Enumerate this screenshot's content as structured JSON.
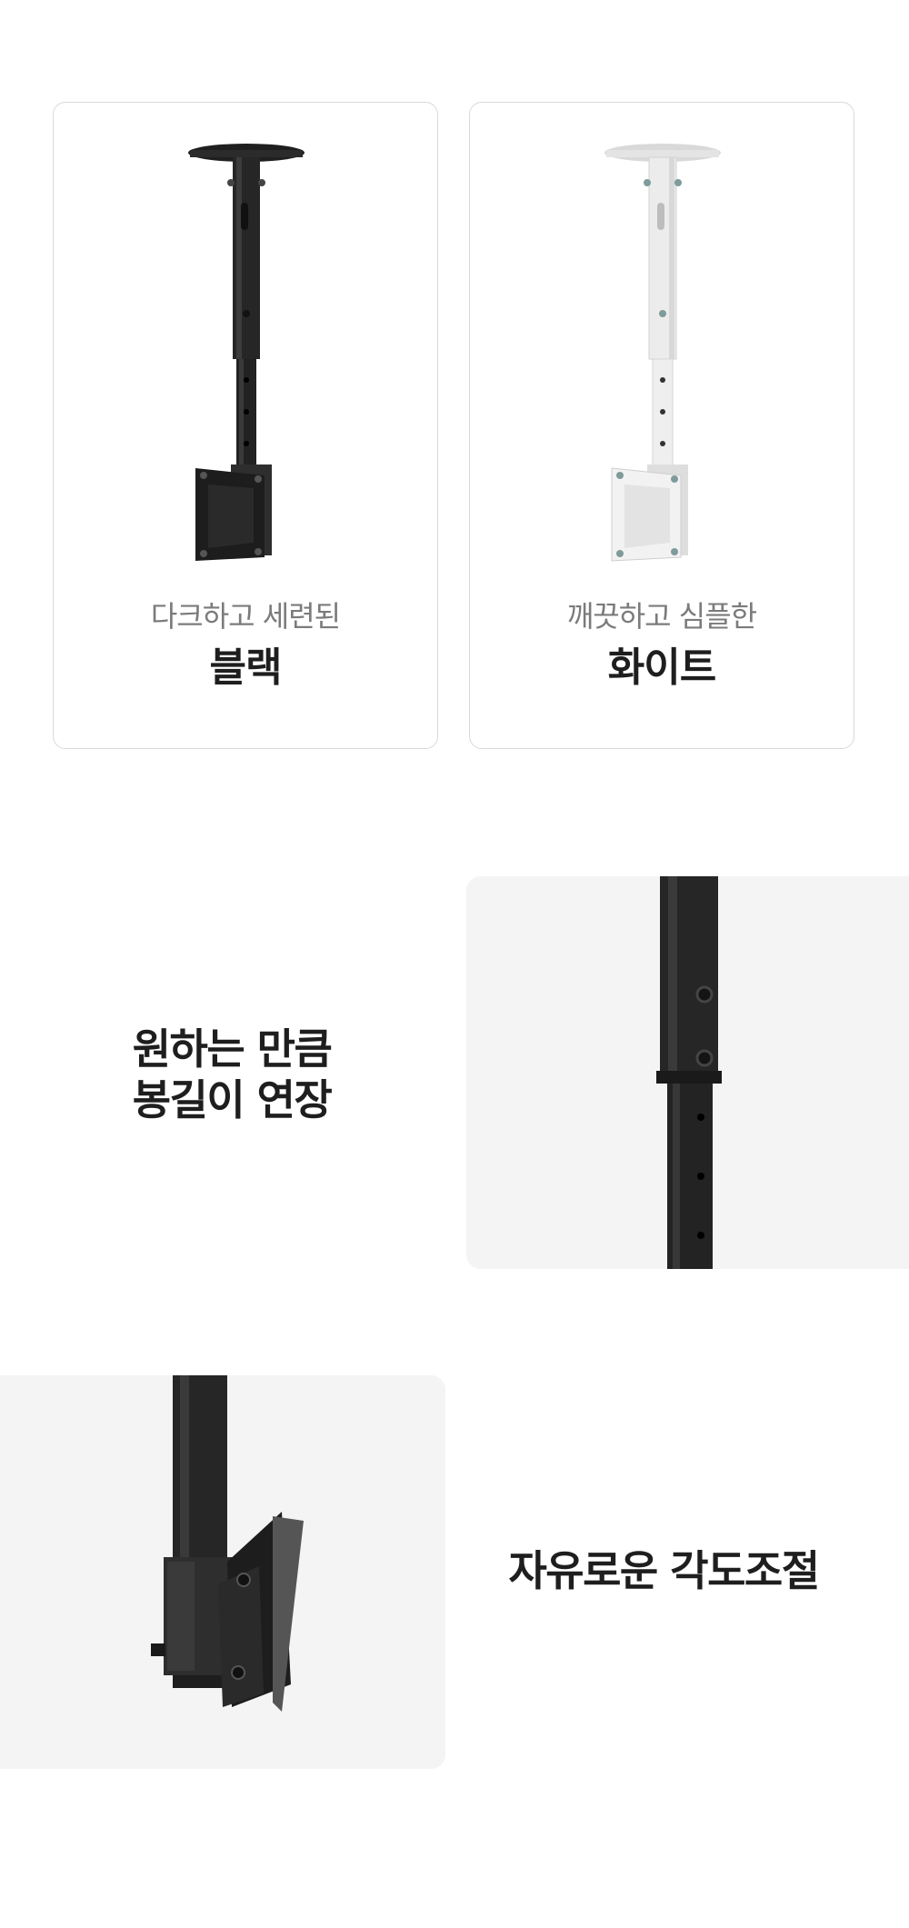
{
  "colors": {
    "card_border": "#d9d9d9",
    "photo_background": "#f4f4f4",
    "subtitle_text": "#7b7b7b",
    "title_text": "#1e1e1e",
    "mount_black": "#2a2a2a",
    "mount_white": "#e6e6e6"
  },
  "variants": [
    {
      "subtitle": "다크하고 세련된",
      "title": "블랙",
      "image": "black-ceiling-mount"
    },
    {
      "subtitle": "깨끗하고 심플한",
      "title": "화이트",
      "image": "white-ceiling-mount"
    }
  ],
  "features": [
    {
      "lines": [
        "원하는 만큼",
        "봉길이 연장"
      ],
      "image": "extendable-pole-closeup"
    },
    {
      "lines": [
        "자유로운 각도조절"
      ],
      "image": "tilt-bracket-closeup"
    }
  ]
}
